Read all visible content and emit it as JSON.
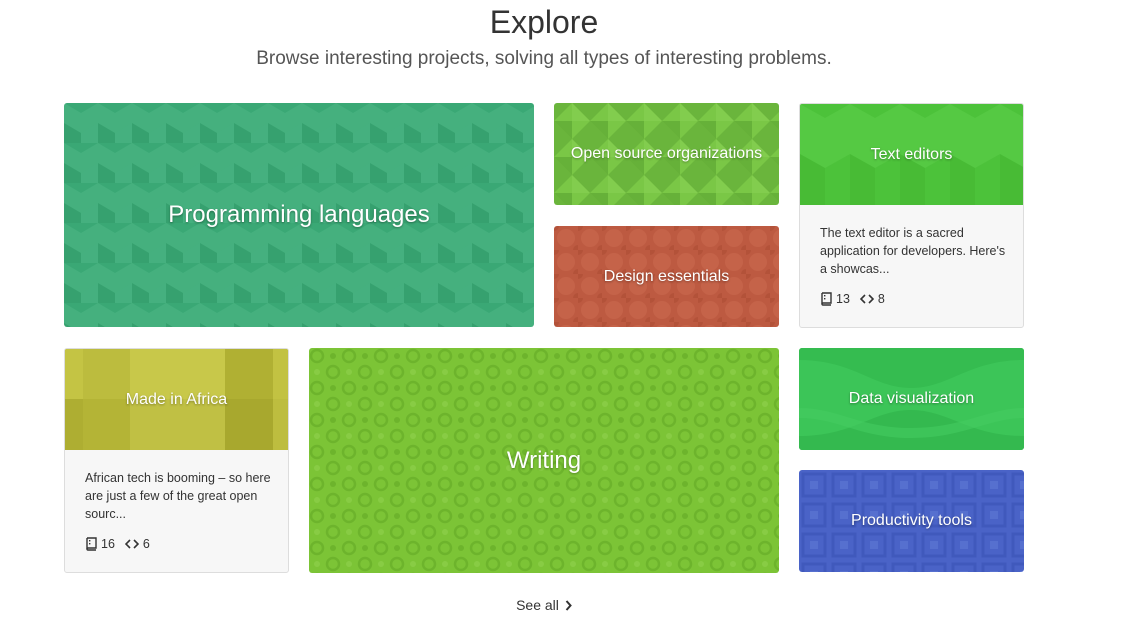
{
  "header": {
    "title": "Explore",
    "subtitle": "Browse interesting projects, solving all types of interesting problems."
  },
  "tiles": {
    "programming_languages": {
      "label": "Programming languages",
      "color": "#3aa875"
    },
    "open_source_orgs": {
      "label": "Open source organizations",
      "color": "#6ec23f"
    },
    "design_essentials": {
      "label": "Design essentials",
      "color": "#c05c42"
    },
    "writing": {
      "label": "Writing",
      "color": "#7cc436"
    },
    "data_visualization": {
      "label": "Data visualization",
      "color": "#3cc558"
    },
    "productivity_tools": {
      "label": "Productivity tools",
      "color": "#4a63c7"
    }
  },
  "cards": {
    "text_editors": {
      "label": "Text editors",
      "description": "The text editor is a sacred application for developers. Here's a showcas...",
      "repos": "13",
      "languages": "8",
      "color": "#4cc23a"
    },
    "made_in_africa": {
      "label": "Made in Africa",
      "description": "African tech is booming – so here are just a few of the great open sourc...",
      "repos": "16",
      "languages": "6",
      "color": "#b8b83a"
    }
  },
  "footer": {
    "see_all": "See all"
  },
  "icons": {
    "repo": "repo-icon",
    "code": "code-icon",
    "chevron": "chevron-right-icon"
  }
}
